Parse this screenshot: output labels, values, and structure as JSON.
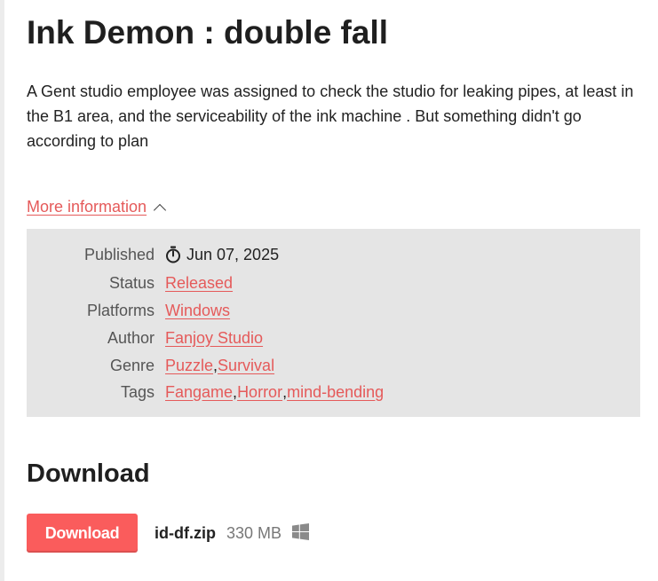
{
  "game": {
    "title": "Ink Demon : double fall",
    "description": "A Gent studio employee was assigned to check the studio for leaking pipes, at least in the B1 area, and the serviceability of the ink machine . But something didn't go according to plan"
  },
  "more_info": {
    "label": "More information"
  },
  "info": {
    "published": {
      "label": "Published",
      "value": "Jun 07, 2025",
      "icon": "stopwatch-icon"
    },
    "status": {
      "label": "Status",
      "value": "Released"
    },
    "platforms": {
      "label": "Platforms",
      "value": "Windows"
    },
    "author": {
      "label": "Author",
      "value": "Fanjoy Studio"
    },
    "genre": {
      "label": "Genre",
      "values": [
        "Puzzle",
        "Survival"
      ],
      "separator": ", "
    },
    "tags": {
      "label": "Tags",
      "values": [
        "Fangame",
        "Horror",
        "mind-bending"
      ],
      "separator": ", "
    }
  },
  "download": {
    "heading": "Download",
    "button_label": "Download",
    "file_name": "id-df.zip",
    "file_size": "330 MB",
    "platform_icon": "windows-icon"
  },
  "colors": {
    "link": "#e55a5a",
    "button": "#fa5c5c",
    "panel": "#e5e5e5"
  }
}
